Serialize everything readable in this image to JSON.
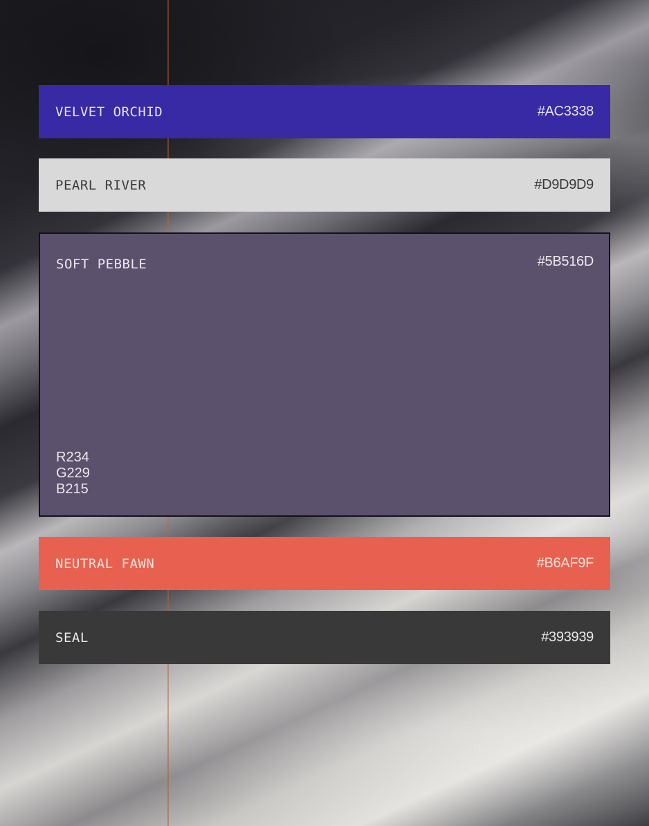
{
  "swatches": [
    {
      "name": "VELVET ORCHID",
      "hex": "#AC3338",
      "fill": "#3829a4"
    },
    {
      "name": "PEARL RIVER",
      "hex": "#D9D9D9",
      "fill": "#d9d9d9"
    },
    {
      "name": "SOFT PEBBLE",
      "hex": "#5B516D",
      "fill": "#5b516d",
      "rgb": {
        "r": "R234",
        "g": "G229",
        "b": "B215"
      }
    },
    {
      "name": "NEUTRAL FAWN",
      "hex": "#B6AF9F",
      "fill": "#e86150"
    },
    {
      "name": "SEAL",
      "hex": "#393939",
      "fill": "#393939"
    }
  ]
}
